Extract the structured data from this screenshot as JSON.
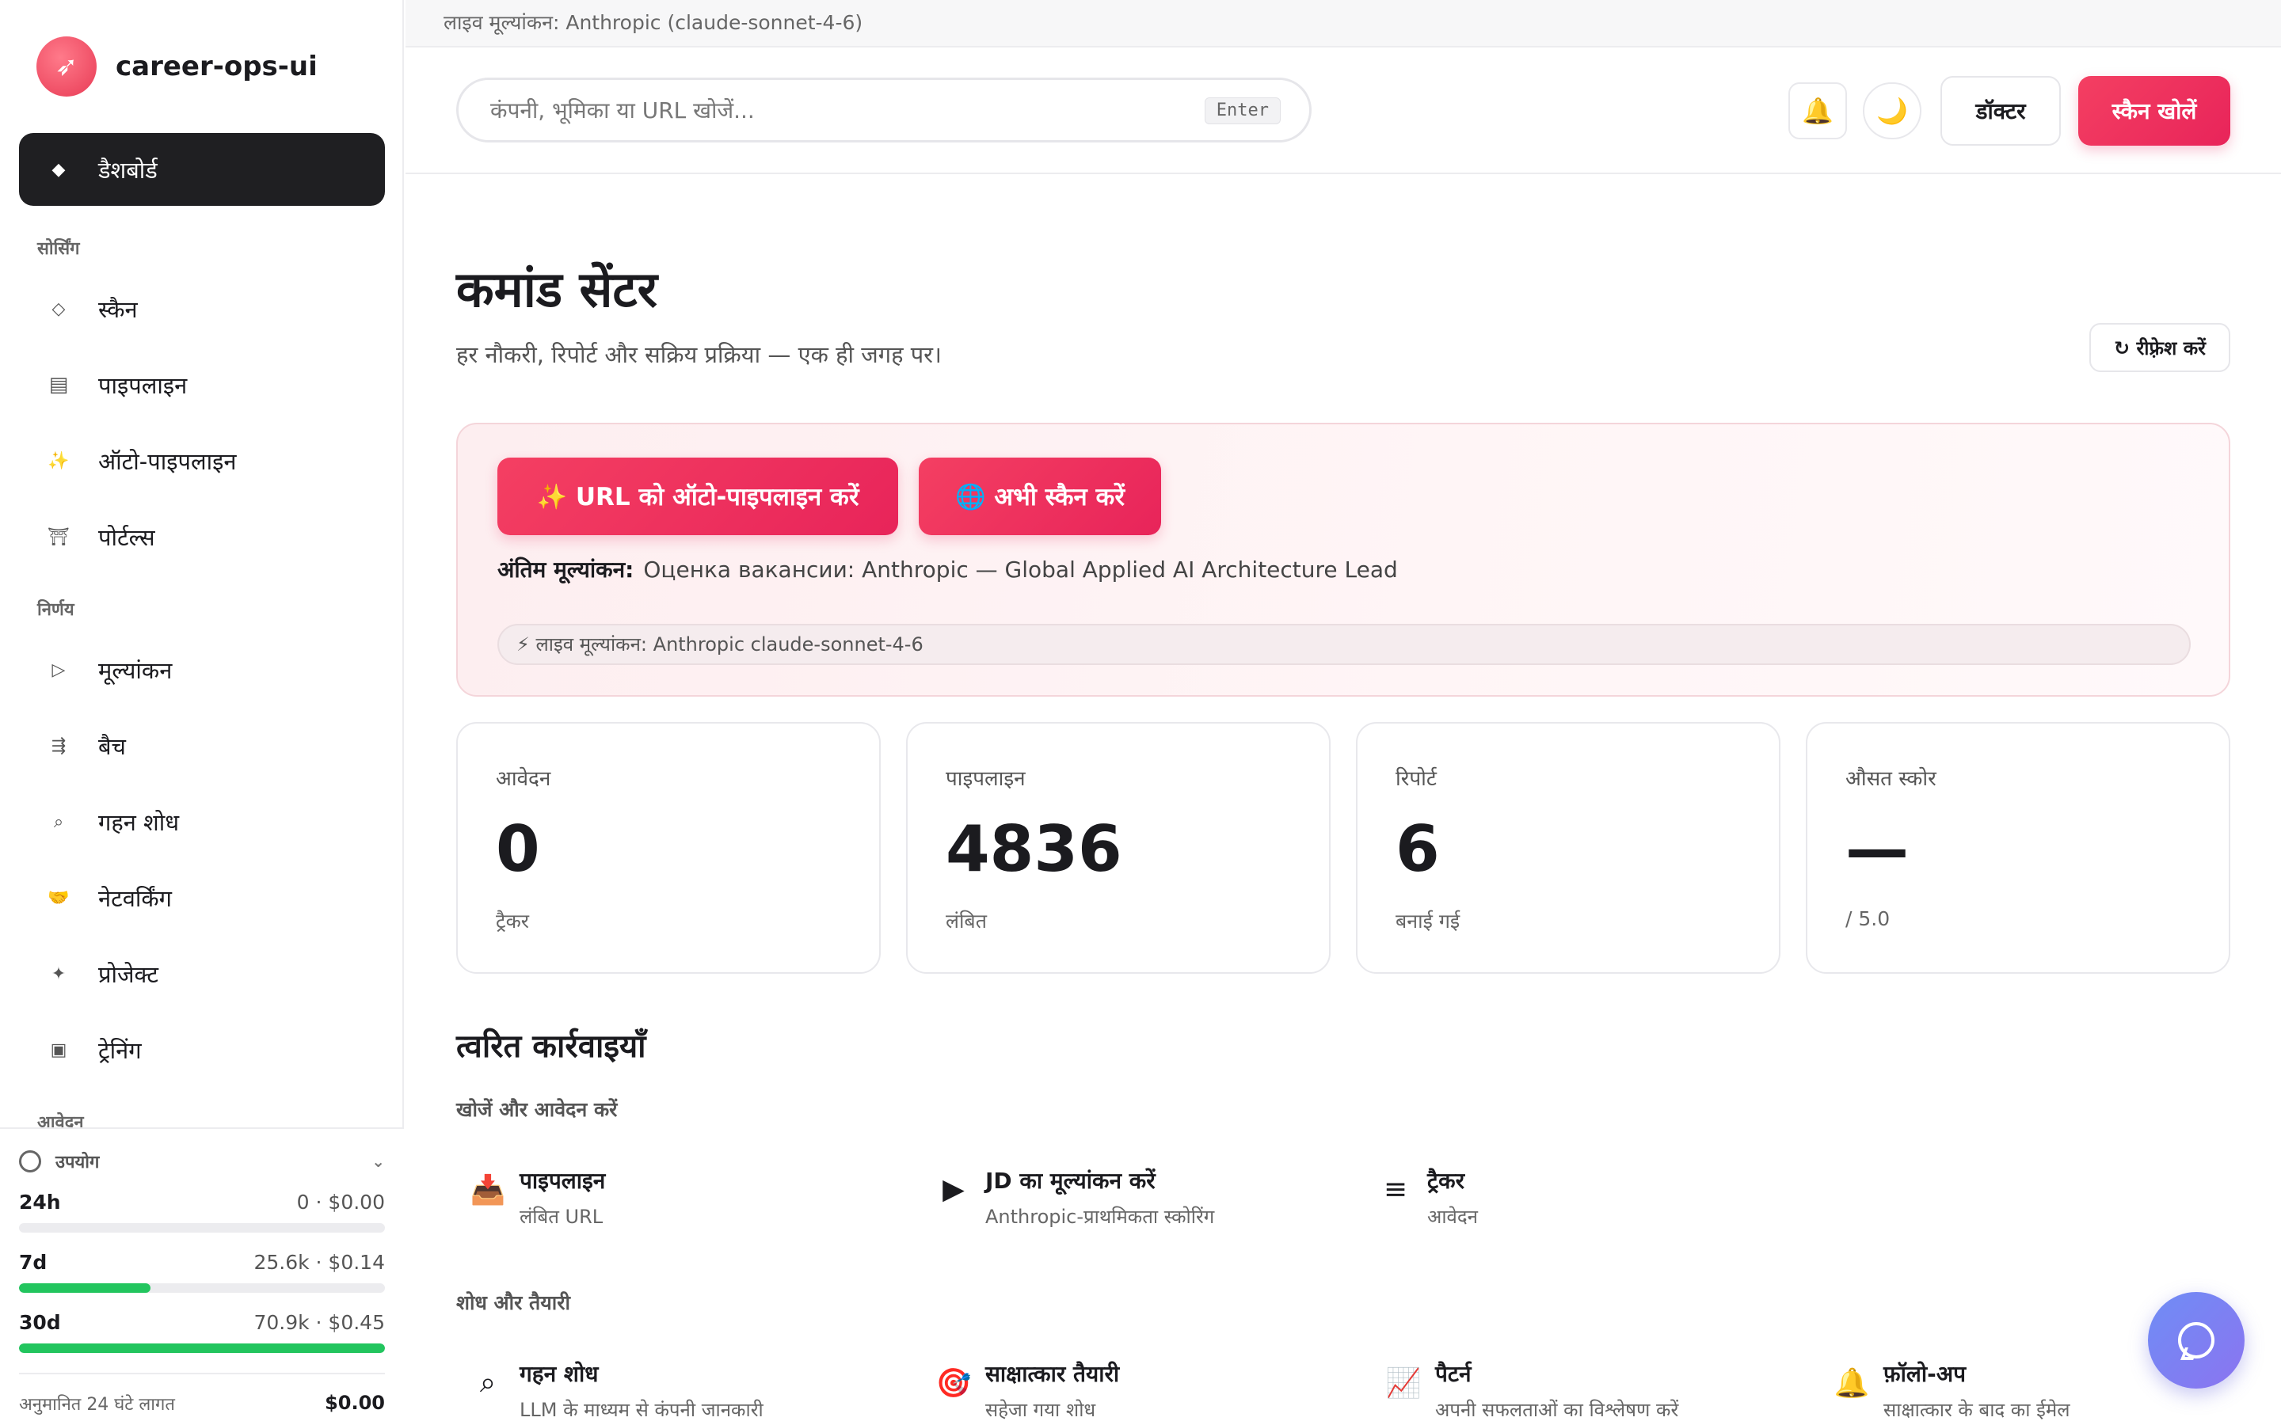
{
  "app": {
    "name": "career-ops-ui"
  },
  "sidebar": {
    "active": {
      "label": "डैशबोर्ड",
      "icon": "◆"
    },
    "sections": [
      {
        "label": "सोर्सिंग"
      },
      {
        "label": "निर्णय"
      },
      {
        "label": "आवेदन"
      }
    ],
    "items": [
      {
        "label": "स्कैन",
        "icon": "◇"
      },
      {
        "label": "पाइपलाइन",
        "icon": "▤"
      },
      {
        "label": "ऑटो-पाइपलाइन",
        "icon": "✨"
      },
      {
        "label": "पोर्टल्स",
        "icon": "⛩"
      },
      {
        "label": "मूल्यांकन",
        "icon": "▷"
      },
      {
        "label": "बैच",
        "icon": "⇶"
      },
      {
        "label": "गहन शोध",
        "icon": "⌕"
      },
      {
        "label": "नेटवर्किंग",
        "icon": "🤝"
      },
      {
        "label": "प्रोजेक्ट",
        "icon": "✦"
      },
      {
        "label": "ट्रेनिंग",
        "icon": "▣"
      }
    ]
  },
  "usage": {
    "title": "उपयोग",
    "caret": "⌄",
    "rows": [
      {
        "period": "24h",
        "value": "0 · $0.00",
        "fill": 0
      },
      {
        "period": "7d",
        "value": "25.6k · $0.14",
        "fill": 0.36
      },
      {
        "period": "30d",
        "value": "70.9k · $0.45",
        "fill": 1.0
      }
    ],
    "estimate_label": "अनुमानित 24 घंटे लागत",
    "estimate_value": "$0.00"
  },
  "topstrip": {
    "text": "लाइव मूल्यांकन: Anthropic (claude-sonnet-4-6)"
  },
  "header": {
    "search_placeholder": "कंपनी, भूमिका या URL खोजें...",
    "search_key": "Enter",
    "bell_icon": "🔔",
    "moon_icon": "🌙",
    "doctor_label": "डॉक्टर",
    "scan_open_label": "स्कैन खोलें"
  },
  "page": {
    "title": "कमांड सेंटर",
    "subtitle": "हर नौकरी, रिपोर्ट और सक्रिय प्रक्रिया — एक ही जगह पर।",
    "refresh_label": "↻ रीफ़्रेश करें"
  },
  "hero": {
    "auto_btn": "✨  URL को ऑटो-पाइपलाइन करें",
    "scan_btn": "🌐  अभी स्कैन करें",
    "last_label": "अंतिम मूल्यांकन:",
    "last_value": "Оценка вакансии: Anthropic — Global Applied AI Architecture Lead",
    "live_pill": "⚡ लाइव मूल्यांकन: Anthropic claude-sonnet-4-6"
  },
  "stats": [
    {
      "label": "आवेदन",
      "value": "0",
      "sub": "ट्रैकर"
    },
    {
      "label": "पाइपलाइन",
      "value": "4836",
      "sub": "लंबित"
    },
    {
      "label": "रिपोर्ट",
      "value": "6",
      "sub": "बनाई गई"
    },
    {
      "label": "औसत स्कोर",
      "value": "—",
      "sub": "/ 5.0"
    }
  ],
  "quick_actions": {
    "title": "त्वरित कार्रवाइयाँ",
    "groups": [
      {
        "label": "खोजें और आवेदन करें",
        "items": [
          {
            "icon": "📥",
            "title": "पाइपलाइन",
            "desc": "लंबित URL"
          },
          {
            "icon": "▶",
            "title": "JD का मूल्यांकन करें",
            "desc": "Anthropic-प्राथमिकता स्कोरिंग"
          },
          {
            "icon": "≡",
            "title": "ट्रैकर",
            "desc": "आवेदन"
          }
        ]
      },
      {
        "label": "शोध और तैयारी",
        "items": [
          {
            "icon": "⌕",
            "title": "गहन शोध",
            "desc": "LLM के माध्यम से कंपनी जानकारी"
          },
          {
            "icon": "🎯",
            "title": "साक्षात्कार तैयारी",
            "desc": "सहेजा गया शोध"
          },
          {
            "icon": "📈",
            "title": "पैटर्न",
            "desc": "अपनी सफलताओं का विश्लेषण करें"
          },
          {
            "icon": "🔔",
            "title": "फ़ॉलो-अप",
            "desc": "साक्षात्कार के बाद का ईमेल"
          }
        ]
      }
    ]
  },
  "colors": {
    "accent": "#e8245a",
    "progress": "#22c55e",
    "active_nav": "#1f1f22",
    "chat": "#7b80f2"
  }
}
